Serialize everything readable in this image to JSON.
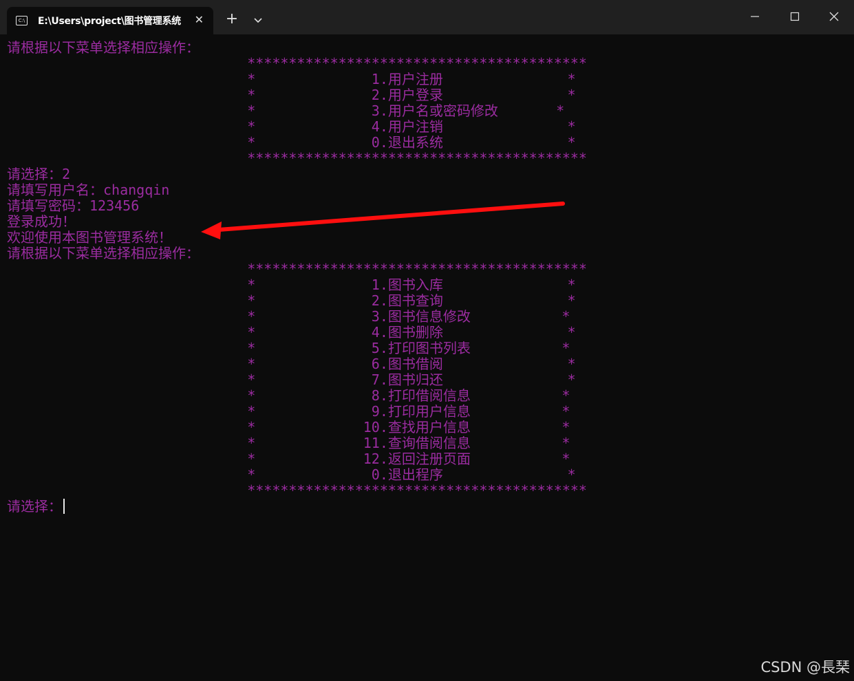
{
  "window": {
    "tab_title": "E:\\Users\\project\\图书管理系统",
    "tab_icon": "C:\\",
    "new_tab_label": "+"
  },
  "console": {
    "lines": [
      "请根据以下菜单选择相应操作：",
      "                             *****************************************",
      "                             *              1.用户注册               *",
      "                             *              2.用户登录               *",
      "                             *              3.用户名或密码修改       *",
      "                             *              4.用户注销               *",
      "                             *              0.退出系统               *",
      "                             *****************************************",
      "请选择：2",
      "请填写用户名：changqin",
      "请填写密码：123456",
      "登录成功！",
      "欢迎使用本图书管理系统！",
      "请根据以下菜单选择相应操作：",
      "                             *****************************************",
      "                             *              1.图书入库               *",
      "                             *              2.图书查询               *",
      "                             *              3.图书信息修改           *",
      "                             *              4.图书删除               *",
      "                             *              5.打印图书列表           *",
      "                             *              6.图书借阅               *",
      "                             *              7.图书归还               *",
      "                             *              8.打印借阅信息           *",
      "                             *              9.打印用户信息           *",
      "                             *             10.查找用户信息           *",
      "                             *             11.查询借阅信息           *",
      "                             *             12.返回注册页面           *",
      "                             *              0.退出程序               *",
      "                             *****************************************"
    ],
    "prompt": "请选择：",
    "text_color": "#9b2ca0",
    "background": "#0c0c0c"
  },
  "annotation": {
    "arrow_color": "#ff0f0f"
  },
  "watermark": "CSDN @長琹"
}
